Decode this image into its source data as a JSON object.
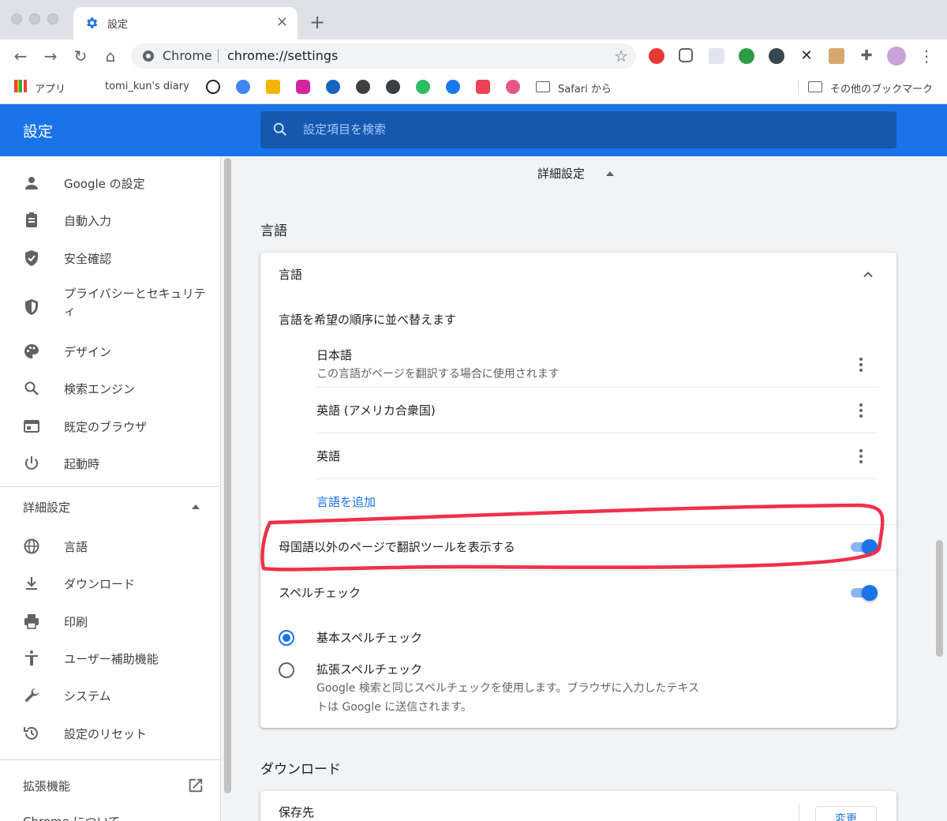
{
  "browser": {
    "tab_title": "設定",
    "site_name": "Chrome",
    "url": "chrome://settings"
  },
  "bookmarks": {
    "apps": "アプリ",
    "diary": "tomi_kun's diary",
    "safari": "Safari から",
    "other": "その他のブックマーク"
  },
  "header": {
    "title": "設定",
    "search_placeholder": "設定項目を検索"
  },
  "sidebar": {
    "items": [
      {
        "label": "Google の設定",
        "icon": "person-icon"
      },
      {
        "label": "自動入力",
        "icon": "clipboard-icon"
      },
      {
        "label": "安全確認",
        "icon": "shield-check-icon"
      },
      {
        "label": "プライバシーとセキュリティ",
        "icon": "security-shield-icon"
      },
      {
        "label": "デザイン",
        "icon": "palette-icon"
      },
      {
        "label": "検索エンジン",
        "icon": "search-icon"
      },
      {
        "label": "既定のブラウザ",
        "icon": "browser-window-icon"
      },
      {
        "label": "起動時",
        "icon": "power-icon"
      }
    ],
    "advanced_label": "詳細設定",
    "advanced_items": [
      {
        "label": "言語",
        "icon": "globe-icon"
      },
      {
        "label": "ダウンロード",
        "icon": "download-icon"
      },
      {
        "label": "印刷",
        "icon": "printer-icon"
      },
      {
        "label": "ユーザー補助機能",
        "icon": "accessibility-icon"
      },
      {
        "label": "システム",
        "icon": "wrench-icon"
      },
      {
        "label": "設定のリセット",
        "icon": "reset-history-icon"
      }
    ],
    "extensions_label": "拡張機能",
    "about_label": "Chrome について"
  },
  "main": {
    "advanced_toggle_label": "詳細設定",
    "language_section_title": "言語",
    "language_card": {
      "header": "言語",
      "order_label": "言語を希望の順序に並べ替えます",
      "languages": [
        {
          "name": "日本語",
          "note": "この言語がページを翻訳する場合に使用されます"
        },
        {
          "name": "英語 (アメリカ合衆国)",
          "note": ""
        },
        {
          "name": "英語",
          "note": ""
        }
      ],
      "add_language": "言語を追加",
      "offer_translate_label": "母国語以外のページで翻訳ツールを表示する",
      "offer_translate_enabled": true,
      "spellcheck_label": "スペルチェック",
      "spellcheck_enabled": true,
      "basic_spellcheck": "基本スペルチェック",
      "enhanced_spellcheck": "拡張スペルチェック",
      "enhanced_desc_line1": "Google 検索と同じスペルチェックを使用します。ブラウザに入力したテキス",
      "enhanced_desc_line2": "トは Google に送信されます。",
      "selected_spellcheck": "basic"
    },
    "download_section_title": "ダウンロード",
    "download_card": {
      "location_label": "保存先",
      "change_button": "変更"
    }
  },
  "colors": {
    "accent": "#1a73e8",
    "annotation": "#f0304a"
  }
}
